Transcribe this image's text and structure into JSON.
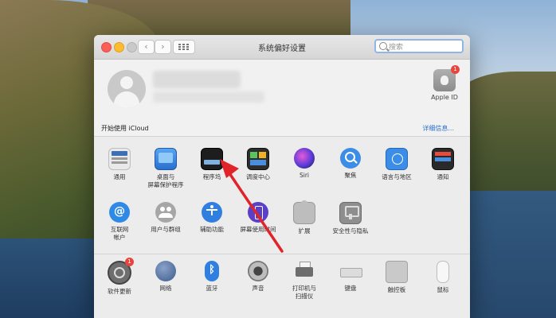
{
  "window": {
    "title": "系统偏好设置",
    "search_placeholder": "搜索"
  },
  "account": {
    "apple_id_label": "Apple ID",
    "apple_id_badge": "1",
    "icloud_text": "开始使用 iCloud",
    "details_link": "详细信息..."
  },
  "prefs_row1": [
    {
      "label": "通用",
      "icon": "general-icon"
    },
    {
      "label": "桌面与\n屏幕保护程序",
      "icon": "desktop-screensaver-icon"
    },
    {
      "label": "程序坞",
      "icon": "dock-icon"
    },
    {
      "label": "调度中心",
      "icon": "mission-control-icon"
    },
    {
      "label": "Siri",
      "icon": "siri-icon"
    },
    {
      "label": "聚焦",
      "icon": "spotlight-icon"
    },
    {
      "label": "语言与地区",
      "icon": "language-region-icon"
    },
    {
      "label": "通知",
      "icon": "notifications-icon"
    }
  ],
  "prefs_row2": [
    {
      "label": "互联网\n帐户",
      "icon": "internet-accounts-icon"
    },
    {
      "label": "用户与群组",
      "icon": "users-groups-icon"
    },
    {
      "label": "辅助功能",
      "icon": "accessibility-icon"
    },
    {
      "label": "屏幕使用时间",
      "icon": "screen-time-icon"
    },
    {
      "label": "扩展",
      "icon": "extensions-icon"
    },
    {
      "label": "安全性与隐私",
      "icon": "security-privacy-icon"
    }
  ],
  "prefs_row3": [
    {
      "label": "软件更新",
      "icon": "software-update-icon",
      "badge": "1"
    },
    {
      "label": "网络",
      "icon": "network-icon"
    },
    {
      "label": "蓝牙",
      "icon": "bluetooth-icon"
    },
    {
      "label": "声音",
      "icon": "sound-icon"
    },
    {
      "label": "打印机与\n扫描仪",
      "icon": "printers-scanners-icon"
    },
    {
      "label": "键盘",
      "icon": "keyboard-icon"
    },
    {
      "label": "触控板",
      "icon": "trackpad-icon"
    },
    {
      "label": "鼠标",
      "icon": "mouse-icon"
    }
  ],
  "colors": {
    "annotation_arrow": "#e0242a",
    "accent": "#2a6fcf"
  }
}
